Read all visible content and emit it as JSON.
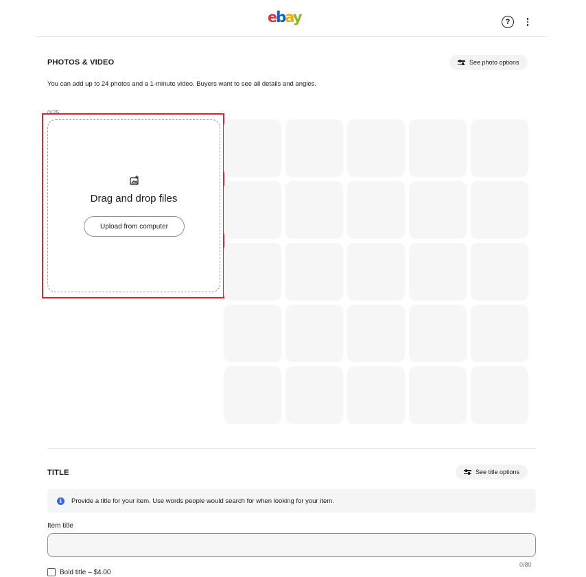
{
  "header": {
    "logo_text": {
      "e": "e",
      "b": "b",
      "a": "a",
      "y": "y"
    },
    "help_label": "?",
    "brand_colors": [
      "#e53238",
      "#0064d2",
      "#f5af02",
      "#86b817"
    ]
  },
  "photos": {
    "title": "PHOTOS & VIDEO",
    "options_label": "See photo options",
    "subtext": "You can add up to 24 photos and a 1-minute video. Buyers want to see all details and angles.",
    "counter": "0/25",
    "drop_text": "Drag and drop files",
    "upload_label": "Upload from computer"
  },
  "title_section": {
    "title": "TITLE",
    "options_label": "See title options",
    "info_text": "Provide a title for your item. Use words people would search for when looking for your item.",
    "field_label": "Item title",
    "value": "",
    "counter": "0/80",
    "bold_label": "Bold title – $4.00"
  },
  "colors": {
    "accent": "#3665f3",
    "highlight": "#e0242a"
  }
}
